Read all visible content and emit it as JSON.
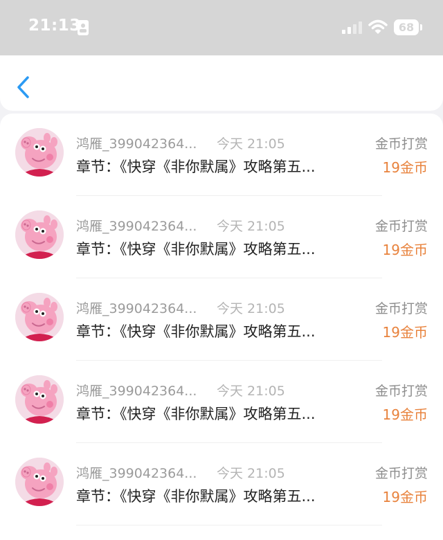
{
  "status_bar": {
    "time": "21:13",
    "battery": "68",
    "icons": [
      "id-card-icon",
      "signal-icon",
      "wifi-icon",
      "battery-icon"
    ]
  },
  "nav": {
    "back_icon": "chevron-left-icon",
    "accent_color": "#2b9af3"
  },
  "colors": {
    "amount": "#e8823c",
    "name": "#9b9b9b"
  },
  "rewards": [
    {
      "name": "鸿雁_399042364...",
      "time": "今天 21:05",
      "action": "金币打赏",
      "chapter": "章节：《快穿《非你默属》攻略第五...",
      "amount": "19金币"
    },
    {
      "name": "鸿雁_399042364...",
      "time": "今天 21:05",
      "action": "金币打赏",
      "chapter": "章节：《快穿《非你默属》攻略第五...",
      "amount": "19金币"
    },
    {
      "name": "鸿雁_399042364...",
      "time": "今天 21:05",
      "action": "金币打赏",
      "chapter": "章节：《快穿《非你默属》攻略第五...",
      "amount": "19金币"
    },
    {
      "name": "鸿雁_399042364...",
      "time": "今天 21:05",
      "action": "金币打赏",
      "chapter": "章节：《快穿《非你默属》攻略第五...",
      "amount": "19金币"
    },
    {
      "name": "鸿雁_399042364...",
      "time": "今天 21:05",
      "action": "金币打赏",
      "chapter": "章节：《快穿《非你默属》攻略第五...",
      "amount": "19金币"
    }
  ]
}
